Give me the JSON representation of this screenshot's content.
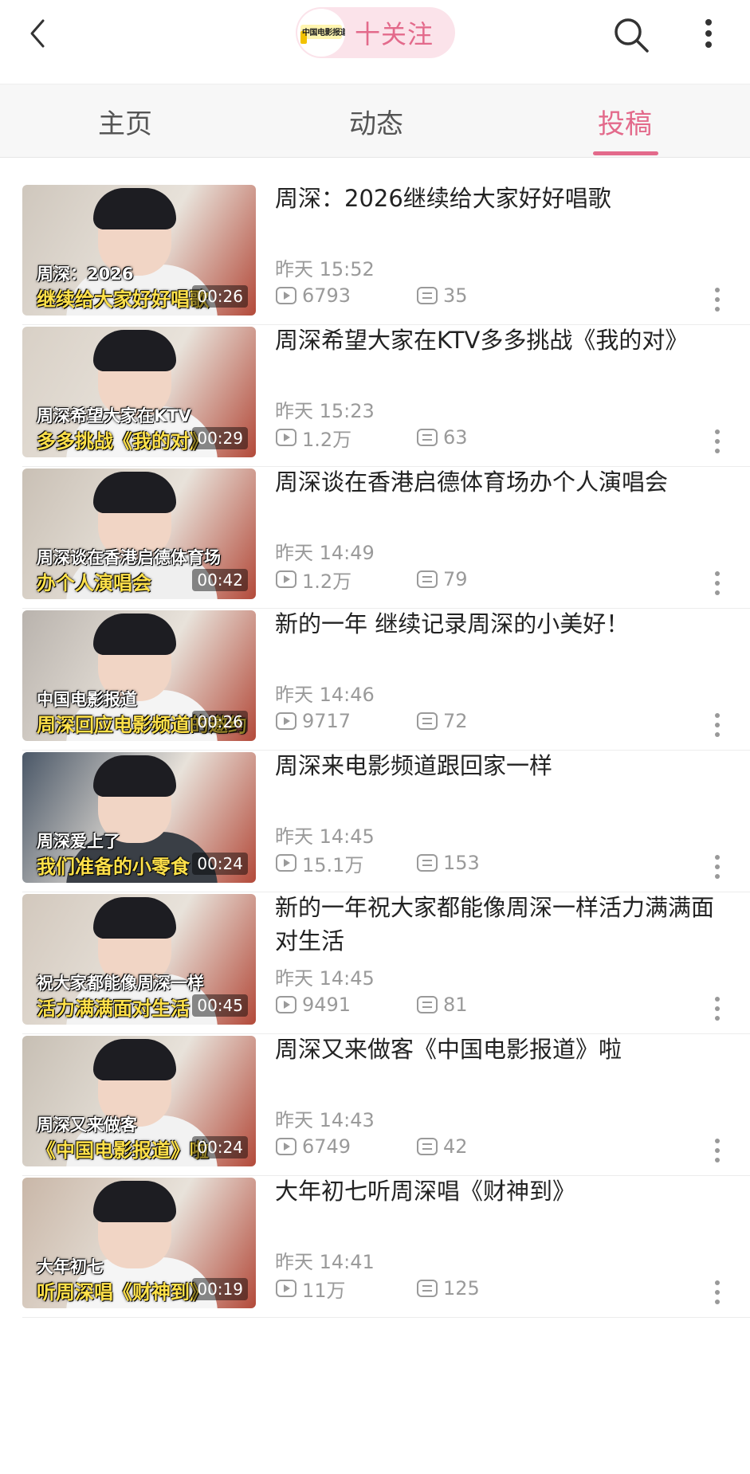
{
  "header": {
    "channel_logo_text": "中国电影报道",
    "follow_label": "十关注",
    "colors": {
      "accent": "#e36a8b",
      "pill_bg": "#fbe3ea"
    },
    "icons": [
      "back-arrow-icon",
      "search-icon",
      "more-vertical-icon"
    ]
  },
  "tabs": [
    {
      "label": "主页",
      "active": false
    },
    {
      "label": "动态",
      "active": false
    },
    {
      "label": "投稿",
      "active": true
    }
  ],
  "videos": [
    {
      "title": "周深：2026继续给大家好好唱歌",
      "time": "昨天 15:52",
      "views": "6793",
      "comments": "35",
      "duration": "00:26",
      "caption_line1": "周深：2026",
      "caption_line2": "继续给大家好好唱歌"
    },
    {
      "title": "周深希望大家在KTV多多挑战《我的对》",
      "time": "昨天 15:23",
      "views": "1.2万",
      "comments": "63",
      "duration": "00:29",
      "caption_line1": "周深希望大家在KTV",
      "caption_line2": "多多挑战《我的对》"
    },
    {
      "title": "周深谈在香港启德体育场办个人演唱会",
      "time": "昨天 14:49",
      "views": "1.2万",
      "comments": "79",
      "duration": "00:42",
      "caption_line1": "周深谈在香港启德体育场",
      "caption_line2": "办个人演唱会"
    },
    {
      "title": "新的一年 继续记录周深的小美好！",
      "time": "昨天 14:46",
      "views": "9717",
      "comments": "72",
      "duration": "00:26",
      "caption_line1": "中国电影报道",
      "caption_line2": "周深回应电影频道的邀约"
    },
    {
      "title": "周深来电影频道跟回家一样",
      "time": "昨天 14:45",
      "views": "15.1万",
      "comments": "153",
      "duration": "00:24",
      "caption_line1": "周深爱上了",
      "caption_line2": "我们准备的小零食"
    },
    {
      "title": "新的一年祝大家都能像周深一样活力满满面对生活",
      "time": "昨天 14:45",
      "views": "9491",
      "comments": "81",
      "duration": "00:45",
      "caption_line1": "祝大家都能像周深一样",
      "caption_line2": "活力满满面对生活"
    },
    {
      "title": "周深又来做客《中国电影报道》啦",
      "time": "昨天 14:43",
      "views": "6749",
      "comments": "42",
      "duration": "00:24",
      "caption_line1": "周深又来做客",
      "caption_line2": "《中国电影报道》啦"
    },
    {
      "title": "大年初七听周深唱《财神到》",
      "time": "昨天 14:41",
      "views": "11万",
      "comments": "125",
      "duration": "00:19",
      "caption_line1": "大年初七",
      "caption_line2": "听周深唱《财神到》"
    }
  ]
}
